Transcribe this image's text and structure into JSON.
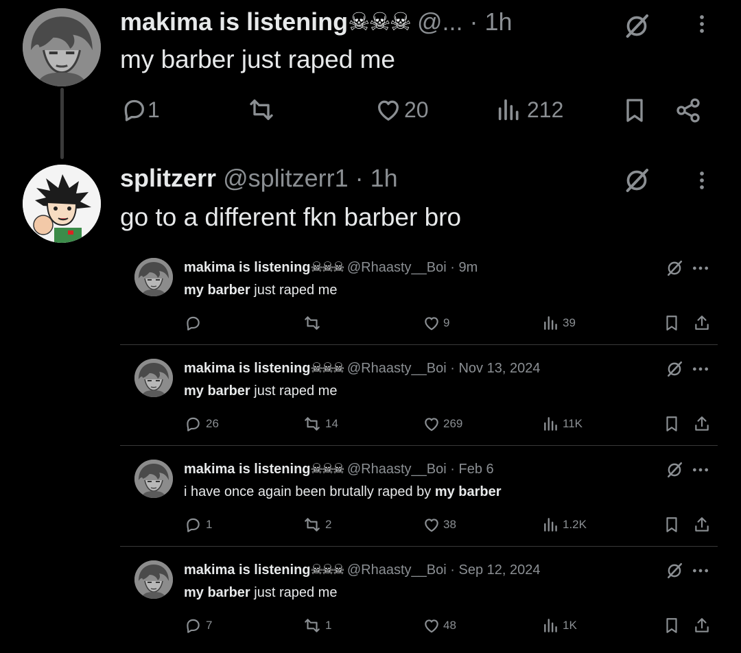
{
  "main_post": {
    "display_name": "makima is listening",
    "skulls": "☠☠☠",
    "handle": "@...",
    "time": "· 1h",
    "text": "my barber just raped me",
    "replies": "1",
    "likes": "20",
    "views": "212"
  },
  "reply_post": {
    "display_name": "splitzerr",
    "handle": "@splitzerr1",
    "time": "· 1h",
    "text": "go to a different fkn barber bro"
  },
  "quoted_posts": [
    {
      "display_name": "makima is listening",
      "skulls": "☠☠☠",
      "handle": "@Rhaasty__Boi",
      "time": "· 9m",
      "text_bold": "my barber",
      "text_rest": " just raped me",
      "replies": "",
      "reposts": "",
      "likes": "9",
      "views": "39"
    },
    {
      "display_name": "makima is listening",
      "skulls": "☠☠☠",
      "handle": "@Rhaasty__Boi",
      "time": "· Nov 13, 2024",
      "text_bold": "my barber",
      "text_rest": " just raped me",
      "replies": "26",
      "reposts": "14",
      "likes": "269",
      "views": "11K"
    },
    {
      "display_name": "makima is listening",
      "skulls": "☠☠☠",
      "handle": "@Rhaasty__Boi",
      "time": "· Feb 6",
      "text_pre": "i have once again been brutally raped by ",
      "text_bold": "my barber",
      "replies": "1",
      "reposts": "2",
      "likes": "38",
      "views": "1.2K"
    },
    {
      "display_name": "makima is listening",
      "skulls": "☠☠☠",
      "handle": "@Rhaasty__Boi",
      "time": "· Sep 12, 2024",
      "text_bold": "my barber",
      "text_rest": " just raped me",
      "replies": "7",
      "reposts": "1",
      "likes": "48",
      "views": "1K"
    }
  ],
  "icons": [
    "grok-icon",
    "more-icon",
    "reply-icon",
    "repost-icon",
    "like-icon",
    "views-icon",
    "bookmark-icon",
    "share-icon"
  ],
  "colors": {
    "background": "#000000",
    "text": "#e7e9ea",
    "muted": "#8b8f93",
    "divider": "#3a3a3a"
  }
}
